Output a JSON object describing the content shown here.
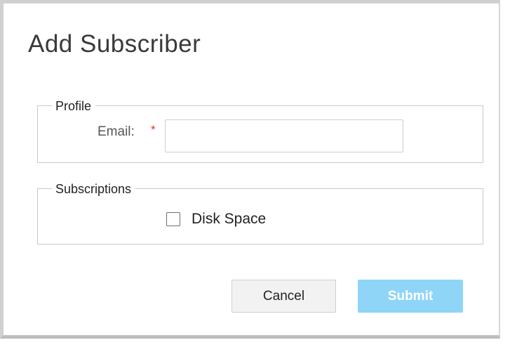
{
  "dialog": {
    "title": "Add Subscriber"
  },
  "profile": {
    "legend": "Profile",
    "email_label": "Email:",
    "required_marker": "*",
    "email_value": "",
    "email_placeholder": ""
  },
  "subscriptions": {
    "legend": "Subscriptions",
    "items": [
      {
        "label": "Disk Space",
        "checked": false
      }
    ]
  },
  "actions": {
    "cancel_label": "Cancel",
    "submit_label": "Submit",
    "submit_disabled": true
  },
  "colors": {
    "required": "#e0342f",
    "submit_bg": "#8fd5f8",
    "cancel_bg": "#f2f2f2"
  }
}
